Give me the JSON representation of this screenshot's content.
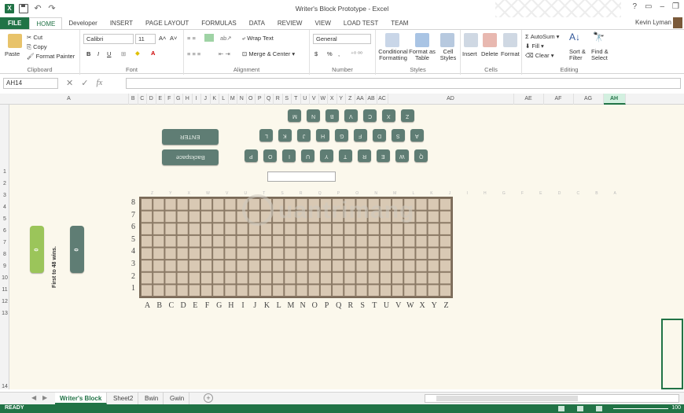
{
  "window": {
    "title": "Writer's Block Prototype - Excel",
    "controls": [
      "?",
      "▭",
      "–",
      "❐"
    ],
    "user": "Kevin Lyman"
  },
  "tabs": [
    "FILE",
    "HOME",
    "Developer",
    "INSERT",
    "PAGE LAYOUT",
    "FORMULAS",
    "DATA",
    "REVIEW",
    "VIEW",
    "LOAD TEST",
    "TEAM"
  ],
  "ribbon": {
    "clipboard": {
      "label": "Clipboard",
      "paste": "Paste",
      "cut": "Cut",
      "copy": "Copy",
      "painter": "Format Painter"
    },
    "font": {
      "label": "Font",
      "name": "Calibri",
      "size": "11",
      "bold": "B",
      "italic": "I",
      "underline": "U",
      "grow": "A˄",
      "shrink": "A˅"
    },
    "alignment": {
      "label": "Alignment",
      "wrap": "Wrap Text",
      "merge": "Merge & Center"
    },
    "number": {
      "label": "Number",
      "format": "General",
      "currency": "$",
      "percent": "%",
      "comma": ","
    },
    "styles": {
      "label": "Styles",
      "conditional": "Conditional Formatting",
      "table": "Format as Table",
      "cell": "Cell Styles"
    },
    "cells": {
      "label": "Cells",
      "insert": "Insert",
      "delete": "Delete",
      "format": "Format"
    },
    "editing": {
      "label": "Editing",
      "autosum": "AutoSum",
      "fill": "Fill",
      "clear": "Clear",
      "sort": "Sort & Filter",
      "find": "Find & Select"
    }
  },
  "formula": {
    "namebox": "AH14",
    "fx": "fx",
    "cancel": "✕",
    "confirm": "✓"
  },
  "columns": [
    "A",
    "B",
    "C",
    "D",
    "E",
    "F",
    "G",
    "H",
    "I",
    "J",
    "K",
    "L",
    "M",
    "N",
    "O",
    "P",
    "Q",
    "R",
    "S",
    "T",
    "U",
    "V",
    "W",
    "X",
    "Y",
    "Z",
    "AA",
    "AB",
    "AC",
    "AD",
    "AE",
    "AF",
    "AG",
    "AH"
  ],
  "selected_column": "AH",
  "rows": [
    "1",
    "2",
    "3",
    "4",
    "5",
    "6",
    "7",
    "8",
    "9",
    "10",
    "11",
    "12",
    "13",
    "14"
  ],
  "keyboard": {
    "row1": [
      "M",
      "N",
      "B",
      "V",
      "C",
      "X",
      "Z"
    ],
    "row2": [
      "L",
      "K",
      "J",
      "H",
      "G",
      "F",
      "D",
      "S",
      "A"
    ],
    "row3": [
      "P",
      "O",
      "I",
      "U",
      "Y",
      "T",
      "R",
      "E",
      "W",
      "Q"
    ],
    "enter": "ENTER",
    "backspace": "Backspace"
  },
  "board": {
    "row_labels": [
      "8",
      "7",
      "6",
      "5",
      "4",
      "3",
      "2",
      "1"
    ],
    "col_labels": [
      "A",
      "B",
      "C",
      "D",
      "E",
      "F",
      "G",
      "H",
      "I",
      "J",
      "K",
      "L",
      "M",
      "N",
      "O",
      "P",
      "Q",
      "R",
      "S",
      "T",
      "U",
      "V",
      "W",
      "X",
      "Y",
      "Z"
    ],
    "top_labels": "Z Y X W V U T S R Q P O N M L K J I H G F E D C B A",
    "rows": 8,
    "cols": 26
  },
  "score": {
    "green": "0",
    "grey": "0",
    "caption": "First to 48 wins.",
    "green_color": "#9bc55a",
    "grey_color": "#5f7d74"
  },
  "watermark": {
    "text": "uantrimang"
  },
  "sheets": [
    "Writer's Block",
    "Sheet2",
    "Bwin",
    "Gwin"
  ],
  "active_sheet": "Writer's Block",
  "status": {
    "text": "READY",
    "zoom": "100"
  },
  "colors": {
    "accent": "#217346",
    "sheet_bg": "#fbf8ec",
    "board": "#8b7a66",
    "key": "#5f7d74"
  }
}
